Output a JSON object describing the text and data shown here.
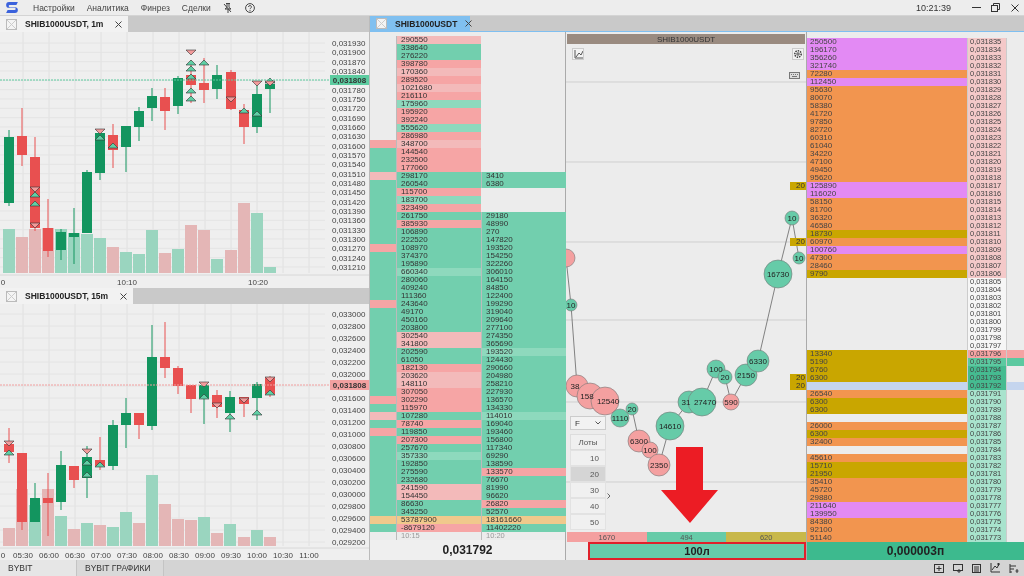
{
  "menu": {
    "items": [
      "Настройки",
      "Аналитика",
      "Финрез",
      "Сделки"
    ],
    "clock": "10:21:39"
  },
  "charts": [
    {
      "tab": "SHIB1000USDT, 1m",
      "price_labels": [
        "0,031930",
        "0,031900",
        "0,031870",
        "0,031840",
        "0,031780",
        "0,031750",
        "0,031720",
        "0,031690",
        "0,031660",
        "0,031630",
        "0,031600",
        "0,031570",
        "0,031540",
        "0,031510",
        "0,031480",
        "0,031450",
        "0,031420",
        "0,031390",
        "0,031360",
        "0,031330",
        "0,031300",
        "0,031270",
        "0,031240",
        "0,031210"
      ],
      "time_labels": [
        "0",
        "10:10",
        "10:20"
      ],
      "last_price": {
        "text": "0,031808",
        "color": "#5ccca0"
      }
    },
    {
      "tab": "SHIB1000USDT, 15m",
      "price_labels": [
        "0,033000",
        "0,032800",
        "0,032600",
        "0,032400",
        "0,032200",
        "0,032000",
        "0,031600",
        "0,031400",
        "0,031200",
        "0,031000",
        "0,030800",
        "0,030600",
        "0,030400",
        "0,030200",
        "0,030000",
        "0,029800",
        "0,029600",
        "0,029400",
        "0,029200"
      ],
      "time_labels": [
        "0",
        "05:30",
        "06:00",
        "06:30",
        "07:00",
        "07:30",
        "08:00",
        "08:30",
        "09:00",
        "09:30",
        "10:00",
        "10:30",
        "11:00"
      ],
      "last_price": {
        "text": "0,031808",
        "color": "#f2a0a0"
      }
    }
  ],
  "workspace_tab": {
    "label": "SHIB1000USDT"
  },
  "trades": {
    "rows": [
      {
        "cells": [
          {
            "text": "290550",
            "color": "#f3baba"
          }
        ]
      },
      {
        "cells": [
          {
            "text": "338640",
            "color": "#72cfae"
          }
        ]
      },
      {
        "cells": [
          {
            "text": "276220",
            "color": "#72cfae"
          }
        ]
      },
      {
        "cells": [
          {
            "text": "398780",
            "color": "#f6a5a5"
          }
        ]
      },
      {
        "cells": [
          {
            "text": "170360",
            "color": "#f3baba"
          }
        ]
      },
      {
        "cells": [
          {
            "text": "289520",
            "color": "#f6a5a5"
          }
        ]
      },
      {
        "cells": [
          {
            "text": "1021680",
            "color": "#f3baba"
          }
        ]
      },
      {
        "cells": [
          {
            "text": "216110",
            "color": "#f6a5a5"
          }
        ]
      },
      {
        "cells": [
          {
            "text": "175960",
            "color": "#8ed9bd"
          }
        ]
      },
      {
        "cells": [
          {
            "text": "195920",
            "color": "#f6a5a5"
          }
        ]
      },
      {
        "cells": [
          {
            "text": "392240",
            "color": "#f6a5a5"
          }
        ]
      },
      {
        "cells": [
          {
            "text": "555620",
            "color": "#8ed9bd"
          }
        ]
      },
      {
        "cells": [
          {
            "text": "286980",
            "color": "#f6a5a5"
          }
        ]
      },
      {
        "marker": {
          "color": "#f6a5a5"
        },
        "cells": [
          {
            "text": "348700",
            "color": "#f3baba"
          }
        ]
      },
      {
        "marker": {
          "color": "#72cfae"
        },
        "cells": [
          {
            "text": "144540",
            "color": "#f6a5a5"
          }
        ]
      },
      {
        "marker": {
          "color": "#72cfae"
        },
        "cells": [
          {
            "text": "232500",
            "color": "#f6a5a5"
          }
        ]
      },
      {
        "marker": {
          "color": "#72cfae"
        },
        "cells": [
          {
            "text": "177060",
            "color": "#f6a5a5"
          }
        ]
      },
      {
        "marker": {
          "color": "#f3baba"
        },
        "cells": [
          {
            "text": "298170",
            "color": "#72cfae"
          },
          {
            "text": "3410",
            "color": "#72cfae"
          }
        ]
      },
      {
        "marker": {
          "color": "#72cfae"
        },
        "cells": [
          {
            "text": "260540",
            "color": "#72cfae"
          },
          {
            "text": "6380",
            "color": "#72cfae"
          }
        ]
      },
      {
        "marker": {
          "color": "#72cfae"
        },
        "cells": [
          {
            "text": "115700",
            "color": "#f6a5a5"
          }
        ]
      },
      {
        "marker": {
          "color": "#72cfae"
        },
        "cells": [
          {
            "text": "183700",
            "color": "#8ed9bd"
          }
        ]
      },
      {
        "marker": {
          "color": "#72cfae"
        },
        "cells": [
          {
            "text": "323490",
            "color": "#f6a5a5"
          }
        ]
      },
      {
        "marker": {
          "color": "#72cfae"
        },
        "cells": [
          {
            "text": "261750",
            "color": "#72cfae"
          },
          {
            "text": "29180",
            "color": "#72cfae"
          }
        ]
      },
      {
        "marker": {
          "color": "#72cfae"
        },
        "cells": [
          {
            "text": "385930",
            "color": "#f6a5a5"
          },
          {
            "text": "48990",
            "color": "#72cfae"
          }
        ]
      },
      {
        "marker": {
          "color": "#72cfae"
        },
        "cells": [
          {
            "text": "106890",
            "color": "#72cfae"
          },
          {
            "text": "270",
            "color": "#72cfae"
          }
        ]
      },
      {
        "marker": {
          "color": "#72cfae"
        },
        "cells": [
          {
            "text": "222520",
            "color": "#72cfae"
          },
          {
            "text": "147820",
            "color": "#72cfae"
          }
        ]
      },
      {
        "marker": {
          "color": "#f6a5a5"
        },
        "cells": [
          {
            "text": "108970",
            "color": "#72cfae"
          },
          {
            "text": "193520",
            "color": "#72cfae"
          }
        ]
      },
      {
        "marker": {
          "color": "#72cfae"
        },
        "cells": [
          {
            "text": "374370",
            "color": "#72cfae"
          },
          {
            "text": "154250",
            "color": "#72cfae"
          }
        ]
      },
      {
        "marker": {
          "color": "#72cfae"
        },
        "cells": [
          {
            "text": "195890",
            "color": "#72cfae"
          },
          {
            "text": "322260",
            "color": "#72cfae"
          }
        ]
      },
      {
        "marker": {
          "color": "#72cfae"
        },
        "cells": [
          {
            "text": "660340",
            "color": "#8ed9bd"
          },
          {
            "text": "306010",
            "color": "#72cfae"
          }
        ]
      },
      {
        "marker": {
          "color": "#72cfae"
        },
        "cells": [
          {
            "text": "280060",
            "color": "#72cfae"
          },
          {
            "text": "164150",
            "color": "#72cfae"
          }
        ]
      },
      {
        "marker": {
          "color": "#72cfae"
        },
        "cells": [
          {
            "text": "409240",
            "color": "#72cfae"
          },
          {
            "text": "84850",
            "color": "#72cfae"
          }
        ]
      },
      {
        "marker": {
          "color": "#72cfae"
        },
        "cells": [
          {
            "text": "111360",
            "color": "#72cfae"
          },
          {
            "text": "122400",
            "color": "#72cfae"
          }
        ]
      },
      {
        "marker": {
          "color": "#f6a5a5"
        },
        "cells": [
          {
            "text": "243640",
            "color": "#72cfae"
          },
          {
            "text": "199290",
            "color": "#72cfae"
          }
        ]
      },
      {
        "marker": {
          "color": "#72cfae"
        },
        "cells": [
          {
            "text": "49170",
            "color": "#72cfae"
          },
          {
            "text": "319040",
            "color": "#72cfae"
          }
        ]
      },
      {
        "marker": {
          "color": "#72cfae"
        },
        "cells": [
          {
            "text": "450160",
            "color": "#72cfae"
          },
          {
            "text": "209640",
            "color": "#72cfae"
          }
        ]
      },
      {
        "marker": {
          "color": "#72cfae"
        },
        "cells": [
          {
            "text": "203800",
            "color": "#72cfae"
          },
          {
            "text": "277100",
            "color": "#72cfae"
          }
        ]
      },
      {
        "marker": {
          "color": "#72cfae"
        },
        "cells": [
          {
            "text": "302540",
            "color": "#f3baba"
          },
          {
            "text": "274350",
            "color": "#72cfae"
          }
        ]
      },
      {
        "marker": {
          "color": "#72cfae"
        },
        "cells": [
          {
            "text": "341800",
            "color": "#f3baba"
          },
          {
            "text": "365690",
            "color": "#72cfae"
          }
        ]
      },
      {
        "marker": {
          "color": "#72cfae"
        },
        "cells": [
          {
            "text": "202590",
            "color": "#72cfae"
          },
          {
            "text": "193520",
            "color": "#8ed9bd"
          }
        ]
      },
      {
        "marker": {
          "color": "#72cfae"
        },
        "cells": [
          {
            "text": "61050",
            "color": "#72cfae"
          },
          {
            "text": "124430",
            "color": "#72cfae"
          }
        ]
      },
      {
        "marker": {
          "color": "#72cfae"
        },
        "cells": [
          {
            "text": "182130",
            "color": "#f6a5a5"
          },
          {
            "text": "290660",
            "color": "#72cfae"
          }
        ]
      },
      {
        "marker": {
          "color": "#72cfae"
        },
        "cells": [
          {
            "text": "203620",
            "color": "#f3baba"
          },
          {
            "text": "204980",
            "color": "#72cfae"
          }
        ]
      },
      {
        "marker": {
          "color": "#72cfae"
        },
        "cells": [
          {
            "text": "148110",
            "color": "#f3baba"
          },
          {
            "text": "258210",
            "color": "#72cfae"
          }
        ]
      },
      {
        "marker": {
          "color": "#72cfae"
        },
        "cells": [
          {
            "text": "307050",
            "color": "#f6a5a5"
          },
          {
            "text": "227930",
            "color": "#72cfae"
          }
        ]
      },
      {
        "marker": {
          "color": "#f6a5a5"
        },
        "cells": [
          {
            "text": "302290",
            "color": "#f6a5a5"
          },
          {
            "text": "136570",
            "color": "#72cfae"
          }
        ]
      },
      {
        "marker": {
          "color": "#72cfae"
        },
        "cells": [
          {
            "text": "115970",
            "color": "#f6a5a5"
          },
          {
            "text": "134330",
            "color": "#72cfae"
          }
        ]
      },
      {
        "marker": {
          "color": "#f3baba"
        },
        "cells": [
          {
            "text": "107280",
            "color": "#72cfae"
          },
          {
            "text": "114010",
            "color": "#8ed9bd"
          }
        ]
      },
      {
        "marker": {
          "color": "#72cfae"
        },
        "cells": [
          {
            "text": "78740",
            "color": "#f6a5a5"
          },
          {
            "text": "169040",
            "color": "#72cfae"
          }
        ]
      },
      {
        "marker": {
          "color": "#f6a5a5"
        },
        "cells": [
          {
            "text": "119850",
            "color": "#72cfae"
          },
          {
            "text": "193460",
            "color": "#72cfae"
          }
        ]
      },
      {
        "marker": {
          "color": "#72cfae"
        },
        "cells": [
          {
            "text": "207300",
            "color": "#f6a5a5"
          },
          {
            "text": "156800",
            "color": "#72cfae"
          }
        ]
      },
      {
        "marker": {
          "color": "#72cfae"
        },
        "cells": [
          {
            "text": "257670",
            "color": "#72cfae"
          },
          {
            "text": "117340",
            "color": "#72cfae"
          }
        ]
      },
      {
        "marker": {
          "color": "#72cfae"
        },
        "cells": [
          {
            "text": "357330",
            "color": "#8ed9bd"
          },
          {
            "text": "69290",
            "color": "#72cfae"
          }
        ]
      },
      {
        "marker": {
          "color": "#72cfae"
        },
        "cells": [
          {
            "text": "192850",
            "color": "#72cfae"
          },
          {
            "text": "138590",
            "color": "#72cfae"
          }
        ]
      },
      {
        "marker": {
          "color": "#72cfae"
        },
        "cells": [
          {
            "text": "275590",
            "color": "#72cfae"
          },
          {
            "text": "133570",
            "color": "#f6a5a5"
          }
        ]
      },
      {
        "marker": {
          "color": "#72cfae"
        },
        "cells": [
          {
            "text": "232680",
            "color": "#72cfae"
          },
          {
            "text": "76670",
            "color": "#72cfae"
          }
        ]
      },
      {
        "marker": {
          "color": "#72cfae"
        },
        "cells": [
          {
            "text": "241590",
            "color": "#f3baba"
          },
          {
            "text": "81990",
            "color": "#72cfae"
          }
        ]
      },
      {
        "marker": {
          "color": "#72cfae"
        },
        "cells": [
          {
            "text": "154450",
            "color": "#f3baba"
          },
          {
            "text": "96620",
            "color": "#72cfae"
          }
        ]
      },
      {
        "marker": {
          "color": "#72cfae"
        },
        "cells": [
          {
            "text": "86630",
            "color": "#72cfae"
          },
          {
            "text": "26820",
            "color": "#f6a5a5"
          }
        ]
      },
      {
        "marker": {
          "color": "#72cfae"
        },
        "cells": [
          {
            "text": "345250",
            "color": "#72cfae"
          },
          {
            "text": "52570",
            "color": "#72cfae"
          }
        ]
      },
      {
        "marker": {
          "color": "#f0c98c"
        },
        "cells": [
          {
            "text": "53787900",
            "color": "#f0c98c"
          },
          {
            "text": "18161660",
            "color": "#f0c98c"
          }
        ]
      },
      {
        "marker": {
          "color": "#72cfae"
        },
        "cells": [
          {
            "text": "-8679120",
            "color": "#f6a5a5"
          },
          {
            "text": "11402220",
            "color": "#72cfae"
          }
        ]
      }
    ],
    "footer_times": [
      "10:15",
      "10:20"
    ],
    "price": "0,031792"
  },
  "cluster": {
    "title": "SHIB1000USDT",
    "bubbles": [
      {
        "color": "#f4a0a0"
      },
      {
        "label": "10",
        "color": "#66cba8"
      },
      {
        "label": "38",
        "color": "#f4a0a0"
      },
      {
        "label": "158",
        "color": "#f4a0a0"
      },
      {
        "label": "12540",
        "color": "#f4a0a0"
      },
      {
        "label": "1110",
        "color": "#66cba8"
      },
      {
        "label": "20",
        "color": "#66cba8"
      },
      {
        "label": "6300",
        "color": "#f4a0a0"
      },
      {
        "label": "100",
        "color": "#f4a0a0"
      },
      {
        "label": "2350",
        "color": "#f4a0a0"
      },
      {
        "label": "14610",
        "color": "#66cba8"
      },
      {
        "label": "31",
        "color": "#66cba8"
      },
      {
        "label": "27470",
        "color": "#66cba8"
      },
      {
        "label": "100",
        "color": "#66cba8"
      },
      {
        "label": "20",
        "color": "#66cba8"
      },
      {
        "label": "590",
        "color": "#f4a0a0"
      },
      {
        "label": "2150",
        "color": "#66cba8"
      },
      {
        "label": "6330",
        "color": "#66cba8"
      },
      {
        "label": "16730",
        "color": "#66cba8"
      },
      {
        "label": "10",
        "color": "#66cba8"
      },
      {
        "label": "10",
        "color": "#66cba8"
      }
    ],
    "filter": "F",
    "lots_header": "Лоты",
    "lots": [
      {
        "label": "10",
        "selected": false
      },
      {
        "label": "20",
        "selected": true
      },
      {
        "label": "30",
        "selected": false
      },
      {
        "label": "40",
        "selected": false
      },
      {
        "label": "50",
        "selected": false
      }
    ],
    "totals": [
      {
        "label": "1670",
        "color": "#f4a0a0"
      },
      {
        "label": "494",
        "color": "#66cba8"
      },
      {
        "label": "620",
        "color": "#c8b84a"
      }
    ],
    "volume_button": "100л"
  },
  "ladder": {
    "rows": [
      {
        "volume": {
          "text": "250500",
          "color": "#e38af4"
        },
        "price": {
          "text": "0,031835",
          "color": "#f4c9c9"
        }
      },
      {
        "volume": {
          "text": "196170",
          "color": "#e38af4"
        },
        "price": {
          "text": "0,031834",
          "color": "#f4c9c9"
        }
      },
      {
        "volume": {
          "text": "356260",
          "color": "#e38af4"
        },
        "price": {
          "text": "0,031833",
          "color": "#f4c9c9"
        }
      },
      {
        "volume": {
          "text": "321740",
          "color": "#e38af4"
        },
        "price": {
          "text": "0,031832",
          "color": "#f4c9c9"
        }
      },
      {
        "volume": {
          "text": "72280",
          "color": "#f2954f"
        },
        "price": {
          "text": "0,031831",
          "color": "#f4c9c9"
        }
      },
      {
        "volume": {
          "text": "112450",
          "color": "#e38af4"
        },
        "price": {
          "text": "0,031830",
          "color": "#f4c9c9"
        }
      },
      {
        "volume": {
          "text": "95630",
          "color": "#f2954f"
        },
        "price": {
          "text": "0,031829",
          "color": "#f4c9c9"
        }
      },
      {
        "volume": {
          "text": "80070",
          "color": "#f2954f"
        },
        "price": {
          "text": "0,031828",
          "color": "#f4c9c9"
        }
      },
      {
        "volume": {
          "text": "58380",
          "color": "#f2954f"
        },
        "price": {
          "text": "0,031827",
          "color": "#f4c9c9"
        }
      },
      {
        "volume": {
          "text": "41720",
          "color": "#f2954f"
        },
        "price": {
          "text": "0,031826",
          "color": "#f4c9c9"
        }
      },
      {
        "volume": {
          "text": "97850",
          "color": "#f2954f"
        },
        "price": {
          "text": "0,031825",
          "color": "#f4c9c9"
        }
      },
      {
        "volume": {
          "text": "82720",
          "color": "#f2954f"
        },
        "price": {
          "text": "0,031824",
          "color": "#f4c9c9"
        }
      },
      {
        "volume": {
          "text": "60310",
          "color": "#f2954f"
        },
        "price": {
          "text": "0,031823",
          "color": "#f4c9c9"
        }
      },
      {
        "volume": {
          "text": "61040",
          "color": "#f2954f"
        },
        "price": {
          "text": "0,031822",
          "color": "#f4c9c9"
        }
      },
      {
        "volume": {
          "text": "34220",
          "color": "#f2954f"
        },
        "price": {
          "text": "0,031821",
          "color": "#f4c9c9"
        }
      },
      {
        "volume": {
          "text": "47100",
          "color": "#f2954f"
        },
        "price": {
          "text": "0,031820",
          "color": "#f4c9c9"
        }
      },
      {
        "volume": {
          "text": "49450",
          "color": "#f2954f"
        },
        "price": {
          "text": "0,031819",
          "color": "#f4c9c9"
        }
      },
      {
        "volume": {
          "text": "95620",
          "color": "#f2954f"
        },
        "price": {
          "text": "0,031818",
          "color": "#f4c9c9"
        }
      },
      {
        "order": "20",
        "volume": {
          "text": "125890",
          "color": "#e38af4"
        },
        "price": {
          "text": "0,031817",
          "color": "#f4c9c9"
        }
      },
      {
        "volume": {
          "text": "116020",
          "color": "#e38af4"
        },
        "price": {
          "text": "0,031816",
          "color": "#f4c9c9"
        }
      },
      {
        "volume": {
          "text": "58150",
          "color": "#f2954f"
        },
        "price": {
          "text": "0,031815",
          "color": "#f4c9c9"
        }
      },
      {
        "volume": {
          "text": "81700",
          "color": "#f2954f"
        },
        "price": {
          "text": "0,031814",
          "color": "#f4c9c9"
        }
      },
      {
        "volume": {
          "text": "36320",
          "color": "#f2954f"
        },
        "price": {
          "text": "0,031813",
          "color": "#f4c9c9"
        }
      },
      {
        "volume": {
          "text": "46580",
          "color": "#f2954f"
        },
        "price": {
          "text": "0,031812",
          "color": "#f4c9c9"
        }
      },
      {
        "volume": {
          "text": "18730",
          "color": "#c9a600"
        },
        "price": {
          "text": "0,031811",
          "color": "#f4c9c9"
        }
      },
      {
        "order": "20",
        "volume": {
          "text": "60970",
          "color": "#f2954f"
        },
        "price": {
          "text": "0,031810",
          "color": "#f4c9c9"
        }
      },
      {
        "volume": {
          "text": "100760",
          "color": "#e38af4"
        },
        "price": {
          "text": "0,031809",
          "color": "#f4c9c9"
        }
      },
      {
        "volume": {
          "text": "47300",
          "color": "#f2954f"
        },
        "price": {
          "text": "0,031808",
          "color": "#f4c9c9"
        }
      },
      {
        "volume": {
          "text": "28460",
          "color": "#f2954f"
        },
        "price": {
          "text": "0,031807",
          "color": "#f4c9c9"
        }
      },
      {
        "volume": {
          "text": "9790",
          "color": "#c9a600"
        },
        "price": {
          "text": "0,031806",
          "color": "#f4c9c9"
        }
      },
      {
        "price": {
          "text": "0,031805",
          "color": "#f6f6f6"
        }
      },
      {
        "price": {
          "text": "0,031804",
          "color": "#f6f6f6"
        }
      },
      {
        "price": {
          "text": "0,031803",
          "color": "#f6f6f6"
        }
      },
      {
        "price": {
          "text": "0,031802",
          "color": "#f6f6f6"
        }
      },
      {
        "price": {
          "text": "0,031801",
          "color": "#f6f6f6"
        }
      },
      {
        "price": {
          "text": "0,031800",
          "color": "#f6f6f6"
        }
      },
      {
        "price": {
          "text": "0,031799",
          "color": "#f6f6f6"
        }
      },
      {
        "price": {
          "text": "0,031798",
          "color": "#f6f6f6"
        }
      },
      {
        "price": {
          "text": "0,031797",
          "color": "#f6f6f6"
        }
      },
      {
        "volume": {
          "text": "13340",
          "color": "#c9a600"
        },
        "price": {
          "text": "0,031796",
          "color": "#f4a3a3"
        },
        "tail": {
          "color": "#f4a3a3"
        }
      },
      {
        "volume": {
          "text": "5190",
          "color": "#c9a600"
        },
        "price": {
          "text": "0,031795",
          "color": "#5cc9a0"
        },
        "tail": {
          "color": "#5cc9a0"
        }
      },
      {
        "volume": {
          "text": "6760",
          "color": "#c9a600"
        },
        "price": {
          "text": "0,031794",
          "color": "#45bb90"
        }
      },
      {
        "order": "20",
        "volume": {
          "text": "6300",
          "color": "#c9a600"
        },
        "price": {
          "text": "0,031793",
          "color": "#45bb90"
        }
      },
      {
        "order": "20",
        "volume": {
          "color": "#c5d5ee"
        },
        "price": {
          "text": "0,031792",
          "color": "#45bb90"
        },
        "tail": {
          "color": "#c5d5ee"
        }
      },
      {
        "volume": {
          "text": "26540",
          "color": "#f2954f"
        },
        "price": {
          "text": "0,031791",
          "color": "#a8e3cd"
        }
      },
      {
        "volume": {
          "text": "6300",
          "color": "#c9a600"
        },
        "price": {
          "text": "0,031790",
          "color": "#a8e3cd"
        }
      },
      {
        "volume": {
          "text": "6300",
          "color": "#c9a600"
        },
        "price": {
          "text": "0,031789",
          "color": "#a8e3cd"
        }
      },
      {
        "price": {
          "text": "0,031788",
          "color": "#a8e3cd"
        }
      },
      {
        "volume": {
          "text": "26000",
          "color": "#f2954f"
        },
        "price": {
          "text": "0,031787",
          "color": "#a8e3cd"
        }
      },
      {
        "volume": {
          "text": "6300",
          "color": "#c9a600"
        },
        "price": {
          "text": "0,031786",
          "color": "#a8e3cd"
        }
      },
      {
        "volume": {
          "text": "32400",
          "color": "#f2954f"
        },
        "price": {
          "text": "0,031785",
          "color": "#a8e3cd"
        }
      },
      {
        "price": {
          "text": "0,031784",
          "color": "#a8e3cd"
        }
      },
      {
        "volume": {
          "text": "45610",
          "color": "#f2954f"
        },
        "price": {
          "text": "0,031783",
          "color": "#a8e3cd"
        }
      },
      {
        "volume": {
          "text": "15710",
          "color": "#c9a600"
        },
        "price": {
          "text": "0,031782",
          "color": "#a8e3cd"
        }
      },
      {
        "volume": {
          "text": "21950",
          "color": "#c9a600"
        },
        "price": {
          "text": "0,031781",
          "color": "#a8e3cd"
        }
      },
      {
        "volume": {
          "text": "35410",
          "color": "#f2954f"
        },
        "price": {
          "text": "0,031780",
          "color": "#a8e3cd"
        }
      },
      {
        "volume": {
          "text": "45720",
          "color": "#f2954f"
        },
        "price": {
          "text": "0,031779",
          "color": "#a8e3cd"
        }
      },
      {
        "volume": {
          "text": "29880",
          "color": "#f2954f"
        },
        "price": {
          "text": "0,031778",
          "color": "#a8e3cd"
        }
      },
      {
        "volume": {
          "text": "211640",
          "color": "#e38af4"
        },
        "price": {
          "text": "0,031777",
          "color": "#a8e3cd"
        }
      },
      {
        "volume": {
          "text": "139950",
          "color": "#e38af4"
        },
        "price": {
          "text": "0,031776",
          "color": "#a8e3cd"
        }
      },
      {
        "volume": {
          "text": "84380",
          "color": "#f2954f"
        },
        "price": {
          "text": "0,031775",
          "color": "#a8e3cd"
        }
      },
      {
        "volume": {
          "text": "92100",
          "color": "#f2954f"
        },
        "price": {
          "text": "0,031774",
          "color": "#a8e3cd"
        }
      },
      {
        "volume": {
          "text": "51140",
          "color": "#f2954f"
        },
        "price": {
          "text": "0,031773",
          "color": "#a8e3cd"
        }
      }
    ],
    "step_button": "0,000003п"
  },
  "status": {
    "tabs": [
      {
        "label": "BYBIT",
        "selected": true
      },
      {
        "label": "BYBIT ГРАФИКИ",
        "selected": false
      }
    ]
  }
}
